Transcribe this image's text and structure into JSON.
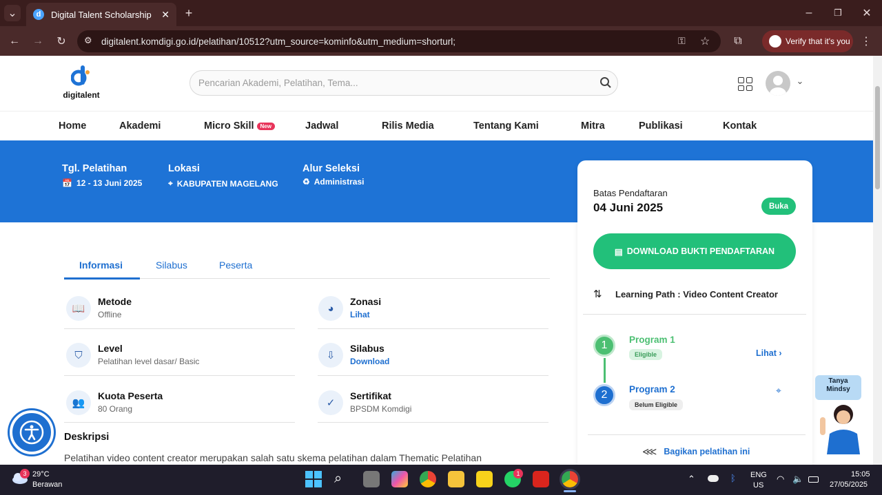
{
  "browser": {
    "tab_title": "Digital Talent Scholarship",
    "url": "digitalent.komdigi.go.id/pelatihan/10512?utm_source=kominfo&utm_medium=shorturl;",
    "verify_label": "Verify that it's you"
  },
  "site": {
    "logo_text": "digitalent",
    "search_placeholder": "Pencarian Akademi, Pelatihan, Tema...",
    "nav": [
      "Home",
      "Akademi",
      "Micro Skill",
      "Jadwal",
      "Rilis Media",
      "Tentang Kami",
      "Mitra",
      "Publikasi",
      "Kontak"
    ],
    "new_badge": "New"
  },
  "hero": {
    "tgl_label": "Tgl. Pelatihan",
    "tgl_value": "12 - 13 Juni 2025",
    "lokasi_label": "Lokasi",
    "lokasi_value": "KABUPATEN MAGELANG",
    "alur_label": "Alur Seleksi",
    "alur_value": "Administrasi"
  },
  "card": {
    "batas_label": "Batas Pendaftaran",
    "batas_date": "04 Juni 2025",
    "status": "Buka",
    "download_label": "DOWNLOAD BUKTI PENDAFTARAN",
    "learning_path": "Learning Path : Video Content Creator",
    "programs": [
      {
        "num": "1",
        "name": "Program 1",
        "badge": "Eligible",
        "action": "Lihat"
      },
      {
        "num": "2",
        "name": "Program 2",
        "badge": "Belum Eligible"
      }
    ],
    "share_label": "Bagikan pelatihan ini"
  },
  "tabs": [
    "Informasi",
    "Silabus",
    "Peserta"
  ],
  "info": {
    "metode_t": "Metode",
    "metode_v": "Offline",
    "level_t": "Level",
    "level_v": "Pelatihan level dasar/ Basic",
    "kuota_t": "Kuota Peserta",
    "kuota_v": "80 Orang",
    "zonasi_t": "Zonasi",
    "zonasi_v": "Lihat",
    "silabus_t": "Silabus",
    "silabus_v": "Download",
    "sertifikat_t": "Sertifikat",
    "sertifikat_v": "BPSDM Komdigi"
  },
  "deskripsi": {
    "title": "Deskripsi",
    "text": "Pelatihan video content creator merupakan salah satu skema pelatihan dalam Thematic Pelatihan"
  },
  "mindsy": {
    "label": "Tanya Mindsy"
  },
  "taskbar": {
    "weather_temp": "29°C",
    "weather_desc": "Berawan",
    "weather_badge": "3",
    "lang": "ENG",
    "region": "US",
    "time": "15:05",
    "date": "27/05/2025",
    "whatsapp_badge": "1"
  },
  "colors": {
    "primary": "#1e73d6",
    "green": "#22c07a"
  }
}
